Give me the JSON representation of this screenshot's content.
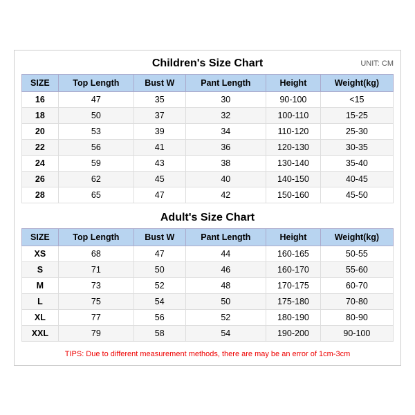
{
  "children_title": "Children's Size Chart",
  "adult_title": "Adult's Size Chart",
  "unit_label": "UNIT: CM",
  "headers": [
    "SIZE",
    "Top Length",
    "Bust W",
    "Pant Length",
    "Height",
    "Weight(kg)"
  ],
  "children_rows": [
    [
      "16",
      "47",
      "35",
      "30",
      "90-100",
      "<15"
    ],
    [
      "18",
      "50",
      "37",
      "32",
      "100-110",
      "15-25"
    ],
    [
      "20",
      "53",
      "39",
      "34",
      "110-120",
      "25-30"
    ],
    [
      "22",
      "56",
      "41",
      "36",
      "120-130",
      "30-35"
    ],
    [
      "24",
      "59",
      "43",
      "38",
      "130-140",
      "35-40"
    ],
    [
      "26",
      "62",
      "45",
      "40",
      "140-150",
      "40-45"
    ],
    [
      "28",
      "65",
      "47",
      "42",
      "150-160",
      "45-50"
    ]
  ],
  "adult_rows": [
    [
      "XS",
      "68",
      "47",
      "44",
      "160-165",
      "50-55"
    ],
    [
      "S",
      "71",
      "50",
      "46",
      "160-170",
      "55-60"
    ],
    [
      "M",
      "73",
      "52",
      "48",
      "170-175",
      "60-70"
    ],
    [
      "L",
      "75",
      "54",
      "50",
      "175-180",
      "70-80"
    ],
    [
      "XL",
      "77",
      "56",
      "52",
      "180-190",
      "80-90"
    ],
    [
      "XXL",
      "79",
      "58",
      "54",
      "190-200",
      "90-100"
    ]
  ],
  "tips": "TIPS: Due to different measurement methods, there are may be an error of 1cm-3cm"
}
